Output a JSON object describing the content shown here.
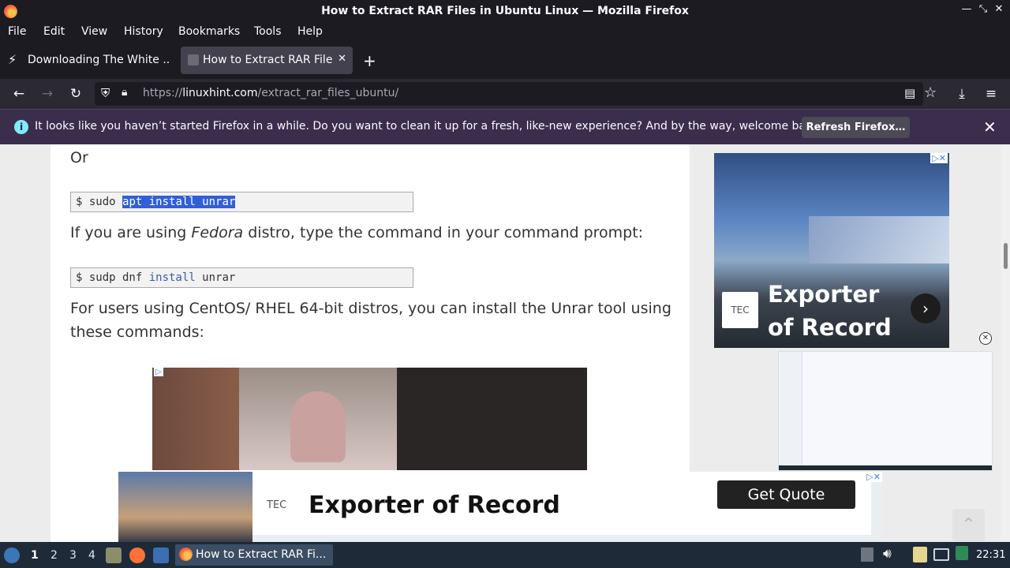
{
  "window": {
    "title": "How to Extract RAR Files in Ubuntu Linux — Mozilla Firefox"
  },
  "menu": [
    "File",
    "Edit",
    "View",
    "History",
    "Bookmarks",
    "Tools",
    "Help"
  ],
  "tabs": [
    {
      "label": "Downloading The White ...",
      "active": false
    },
    {
      "label": "How to Extract RAR Files",
      "active": true
    }
  ],
  "url": {
    "prefix": "https://",
    "domain": "linuxhint.com",
    "path": "/extract_rar_files_ubuntu/"
  },
  "notification": {
    "text": "It looks like you haven’t started Firefox in a while. Do you want to clean it up for a fresh, like-new experience? And by the way, welcome back!",
    "button": "Refresh Firefox…"
  },
  "article": {
    "or": "Or",
    "cmd1": {
      "prompt": "$ sudo ",
      "selected": "apt install unrar"
    },
    "fedora_pre": "If you are using ",
    "fedora_em": "Fedora",
    "fedora_post": " distro, type the command in your command prompt:",
    "cmd2": {
      "prompt": "$ sudp dnf ",
      "kw": "install",
      "rest": " unrar"
    },
    "centos_line1": "For users using CentOS/ RHEL 64-bit distros, you can install the Unrar tool using",
    "centos_line2": "these commands:"
  },
  "side_ad": {
    "brand": "TEC",
    "headline": "Exporter of Record"
  },
  "bottom_ad": {
    "brand": "TEC",
    "headline": "Exporter of Record",
    "cta": "Get Quote"
  },
  "taskbar": {
    "workspaces": [
      "1",
      "2",
      "3",
      "4"
    ],
    "active_workspace": "1",
    "window_label": "How to Extract RAR Fi...",
    "clock": "22:31"
  },
  "colors": {
    "accent": "#3060d8",
    "notification_bg": "#3a2e4c",
    "taskbar_bg": "#1e2a38"
  }
}
